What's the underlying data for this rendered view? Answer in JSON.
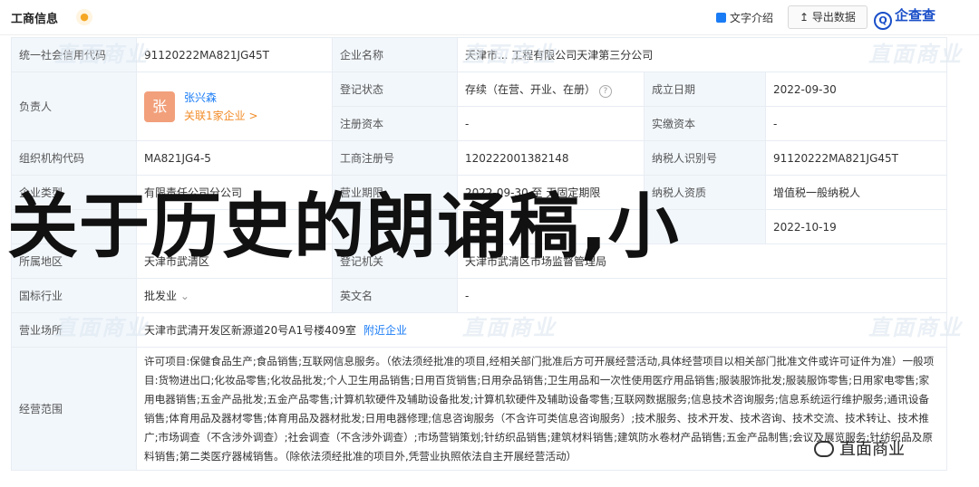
{
  "header": {
    "title": "工商信息",
    "intro_label": "文字介绍",
    "export_label": "导出数据",
    "logo_text": "企查查",
    "bell_icon": "bell-icon"
  },
  "rows": {
    "credit_code_label": "统一社会信用代码",
    "credit_code_value": "91120222MA821JG45T",
    "company_name_label": "企业名称",
    "company_name_value": "天津市... 工程有限公司天津第三分公司",
    "legal_rep_label": "负责人",
    "legal_rep_avatar": "张",
    "legal_rep_name": "张兴森",
    "legal_rep_related": "关联1家企业 >",
    "reg_status_label": "登记状态",
    "reg_status_value": "存续（在营、开业、在册）",
    "established_label": "成立日期",
    "established_value": "2022-09-30",
    "reg_capital_label": "注册资本",
    "reg_capital_value": "-",
    "paid_capital_label": "实缴资本",
    "paid_capital_value": "-",
    "org_code_label": "组织机构代码",
    "org_code_value": "MA821JG4-5",
    "biz_reg_no_label": "工商注册号",
    "biz_reg_no_value": "120222001382148",
    "taxpayer_id_label": "纳税人识别号",
    "taxpayer_id_value": "91120222MA821JG45T",
    "company_type_label": "企业类型",
    "company_type_value": "有限责任公司分公司",
    "biz_term_label": "营业期限",
    "biz_term_value": "2022-09-30 至 无固定期限",
    "taxpayer_qual_label": "纳税人资质",
    "taxpayer_qual_value": "增值税一般纳税人",
    "approval_date_value": "2022-10-19",
    "region_label": "所属地区",
    "region_value": "天津市武清区",
    "reg_authority_label": "登记机关",
    "reg_authority_value": "天津市武清区市场监督管理局",
    "industry_label": "国标行业",
    "industry_value": "批发业",
    "en_name_label": "英文名",
    "en_name_value": "-",
    "address_label": "营业场所",
    "address_value": "天津市武清开发区新源道20号A1号楼409室",
    "nearby_link": "附近企业",
    "scope_label": "经营范围",
    "scope_value": "许可项目:保健食品生产;食品销售;互联网信息服务。（依法须经批准的项目,经相关部门批准后方可开展经营活动,具体经营项目以相关部门批准文件或许可证件为准）一般项目:货物进出口;化妆品零售;化妆品批发;个人卫生用品销售;日用百货销售;日用杂品销售;卫生用品和一次性使用医疗用品销售;服装服饰批发;服装服饰零售;日用家电零售;家用电器销售;五金产品批发;五金产品零售;计算机软硬件及辅助设备批发;计算机软硬件及辅助设备零售;互联网数据服务;信息技术咨询服务;信息系统运行维护服务;通讯设备销售;体育用品及器材零售;体育用品及器材批发;日用电器修理;信息咨询服务（不含许可类信息咨询服务）;技术服务、技术开发、技术咨询、技术交流、技术转让、技术推广;市场调查（不含涉外调查）;社会调查（不含涉外调查）;市场营销策划;针纺织品销售;建筑材料销售;建筑防水卷材产品销售;五金产品制售;会议及展览服务;针纺织品及原料销售;第二类医疗器械销售。（除依法须经批准的项目外,凭营业执照依法自主开展经营活动）"
  },
  "overlay": {
    "title": "关于历史的朗诵稿,小",
    "watermark": "直面商业",
    "wechat_label": "直面商业",
    "wechat_icon": "wechat-icon"
  },
  "colors": {
    "label_bg": "#f2f7fc",
    "link": "#1a7cf5",
    "avatar_bg": "#f2a07b",
    "brand": "#1a4fc9"
  }
}
